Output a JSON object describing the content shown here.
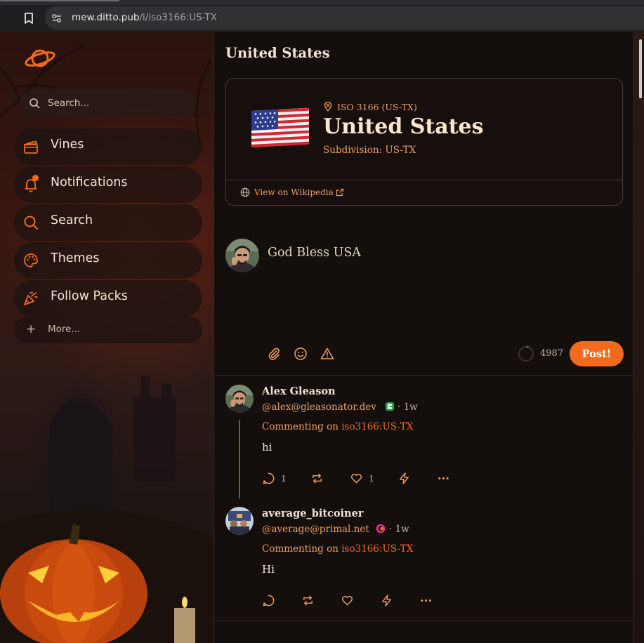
{
  "browser": {
    "url_host": "mew.ditto.pub",
    "url_path": "/i/iso3166:US-TX"
  },
  "sidebar": {
    "search_placeholder": "Search...",
    "items": [
      {
        "label": "Vines",
        "icon": "clapperboard-icon"
      },
      {
        "label": "Notifications",
        "icon": "bell-icon"
      },
      {
        "label": "Search",
        "icon": "search-icon"
      },
      {
        "label": "Themes",
        "icon": "palette-icon"
      },
      {
        "label": "Follow Packs",
        "icon": "party-popper-icon"
      }
    ],
    "more_label": "More...",
    "accent": "#f26b1d"
  },
  "page": {
    "title": "United States"
  },
  "geo_card": {
    "flag": "🇺🇸",
    "iso_label": "ISO 3166 (US-TX)",
    "country": "United States",
    "subdivision": "Subdivision: US-TX",
    "wiki_link": "View on Wikipedia"
  },
  "composer": {
    "text": "God Bless USA",
    "char_remaining": "4987",
    "post_label": "Post!",
    "tools": [
      "paperclip-icon",
      "smile-icon",
      "warning-icon"
    ]
  },
  "posts": [
    {
      "name": "Alex Gleason",
      "handle": "@alex@gleasonator.dev",
      "age": "· 1w",
      "context_prefix": "Commenting on",
      "context_link": "iso3166:US-TX",
      "body": "hi",
      "replies": "1",
      "likes": "1"
    },
    {
      "name": "average_bitcoiner",
      "handle": "@average@primal.net",
      "age": "· 1w",
      "context_prefix": "Commenting on",
      "context_link": "iso3166:US-TX",
      "body": "Hi",
      "replies": "",
      "likes": ""
    }
  ]
}
